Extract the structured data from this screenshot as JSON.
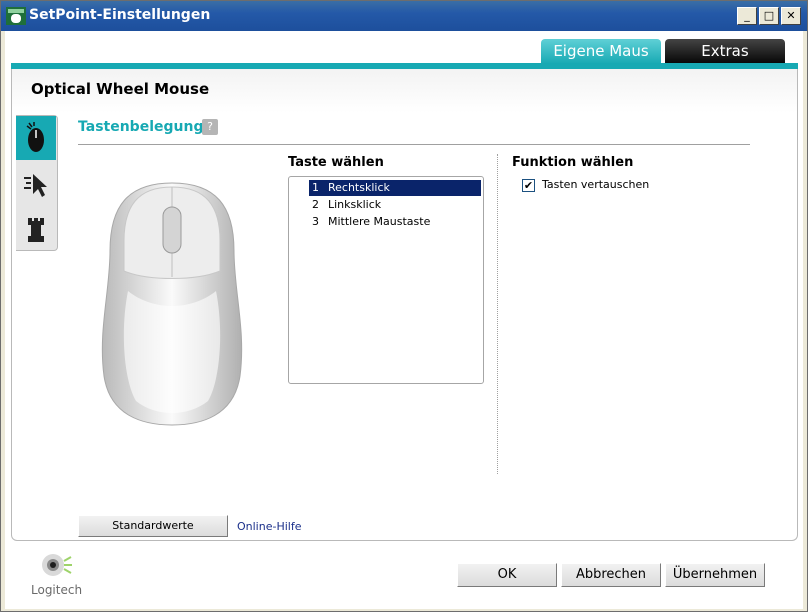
{
  "window": {
    "title": "SetPoint-Einstellungen"
  },
  "titlebar_buttons": {
    "minimize": "_",
    "maximize": "□",
    "close": "✕"
  },
  "tabs": [
    {
      "label": "Eigene Maus",
      "active": true
    },
    {
      "label": "Extras",
      "active": false
    }
  ],
  "device": {
    "name": "Optical Wheel Mouse"
  },
  "side_tabs": [
    {
      "icon": "mouse-icon",
      "active": true
    },
    {
      "icon": "pointer-icon",
      "active": false
    },
    {
      "icon": "chess-rook-icon",
      "active": false
    }
  ],
  "section": {
    "title": "Tastenbelegung",
    "help": "?"
  },
  "button_select": {
    "title": "Taste wählen",
    "items": [
      {
        "num": "1",
        "label": "Rechtsklick",
        "selected": true
      },
      {
        "num": "2",
        "label": "Linksklick",
        "selected": false
      },
      {
        "num": "3",
        "label": "Mittlere Maustaste",
        "selected": false
      }
    ]
  },
  "function_select": {
    "title": "Funktion wählen",
    "checkbox_label": "Tasten vertauschen",
    "checked": true,
    "check_mark": "✔"
  },
  "footer": {
    "defaults_button": "Standardwerte",
    "online_help": "Online-Hilfe",
    "logo_text": "Logitech"
  },
  "dialog_buttons": {
    "ok": "OK",
    "cancel": "Abbrechen",
    "apply": "Übernehmen"
  },
  "colors": {
    "accent": "#17a9b3",
    "titlebar": "#2459a8",
    "selection": "#0a246a"
  }
}
